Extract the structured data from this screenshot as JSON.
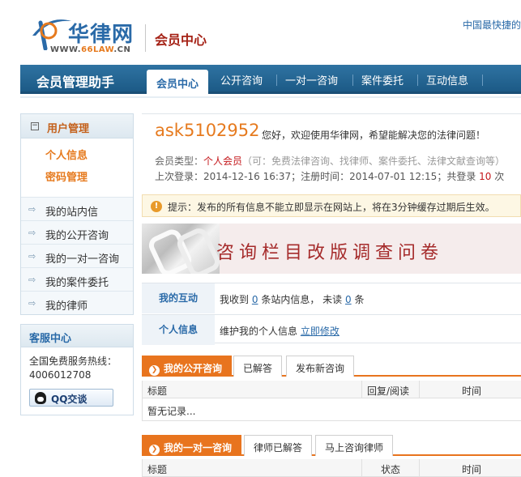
{
  "header": {
    "logo_cn": "华律网",
    "logo_url_prefix": "WWW.",
    "logo_url_accent": "66LAW",
    "logo_url_suffix": ".CN",
    "site_title": "会员中心",
    "slogan": "中国最快捷的"
  },
  "nav": {
    "title": "会员管理助手",
    "tabs": [
      {
        "label": "会员中心",
        "active": true
      },
      {
        "label": "公开咨询"
      },
      {
        "label": "一对一咨询"
      },
      {
        "label": "案件委托"
      },
      {
        "label": "互动信息"
      }
    ]
  },
  "sidebar": {
    "section_title": "用户管理",
    "collapse_symbol": "−",
    "sub_items": [
      "个人信息",
      "密码管理"
    ],
    "links": [
      "我的站内信",
      "我的公开咨询",
      "我的一对一咨询",
      "我的案件委托",
      "我的律师"
    ]
  },
  "service": {
    "title": "客服中心",
    "hotline_label": "全国免费服务热线：",
    "hotline_number": "4006012708",
    "qq_label": "QQ交谈"
  },
  "welcome": {
    "username": "ask5102952",
    "greeting": "您好，欢迎使用华律网，希望能解决您的法律问题！",
    "member_type_label": "会员类型：",
    "member_type": "个人会员",
    "member_type_note": "（可：免费法律咨询、找律师、案件委托、法律文献查询等）",
    "last_login_label": "上次登录：",
    "last_login": "2014-12-16 16:37",
    "register_label": "；注册时间：",
    "register_time": "2014-07-01 12:15",
    "login_count_label": "；共登录",
    "login_count": "10",
    "login_count_unit": "次"
  },
  "tip": {
    "icon_symbol": "!",
    "text": "提示：发布的所有信息不能立即显示在网站上，将在3分钟缓存过期后生效。"
  },
  "banner": {
    "text": "咨询栏目改版调查问卷"
  },
  "interaction": {
    "row1_label": "我的互动",
    "row1_text_a": "我收到",
    "row1_count": "0",
    "row1_text_b": "条站内信息，",
    "row1_text_c": "未读",
    "row1_unread": "0",
    "row1_text_d": "条",
    "row2_label": "个人信息",
    "row2_text": "维护我的个人信息",
    "row2_link": "立即修改"
  },
  "public_consult": {
    "tabs": [
      "我的公开咨询",
      "已解答",
      "发布新咨询"
    ],
    "columns": [
      "标题",
      "回复/阅读",
      "时间"
    ],
    "empty_text": "暂无记录..."
  },
  "one_on_one": {
    "tabs": [
      "我的一对一咨询",
      "律师已解答",
      "马上咨询律师"
    ],
    "columns": [
      "标题",
      "状态",
      "时间"
    ]
  },
  "colors": {
    "brand_blue": "#2a6aa8",
    "accent_orange": "#e8741e",
    "nav_bar": "#1c5a86",
    "alert_red": "#c4171b"
  }
}
